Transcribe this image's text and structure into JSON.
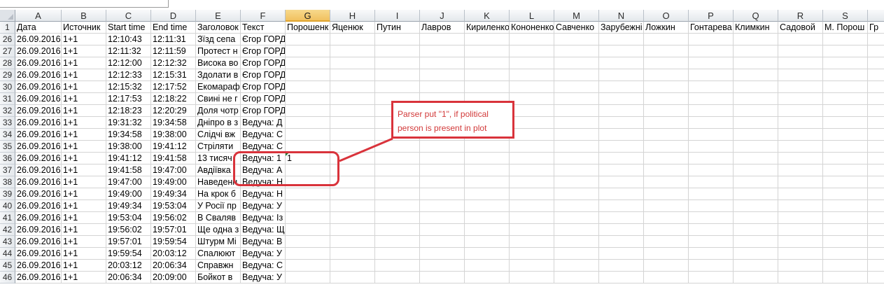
{
  "columns": [
    {
      "letter": "A",
      "width": 66
    },
    {
      "letter": "B",
      "width": 64
    },
    {
      "letter": "C",
      "width": 64
    },
    {
      "letter": "D",
      "width": 64
    },
    {
      "letter": "E",
      "width": 64
    },
    {
      "letter": "F",
      "width": 64
    },
    {
      "letter": "G",
      "width": 64,
      "selected": true
    },
    {
      "letter": "H",
      "width": 64
    },
    {
      "letter": "I",
      "width": 64
    },
    {
      "letter": "J",
      "width": 64
    },
    {
      "letter": "K",
      "width": 64
    },
    {
      "letter": "L",
      "width": 64
    },
    {
      "letter": "M",
      "width": 64
    },
    {
      "letter": "N",
      "width": 64
    },
    {
      "letter": "O",
      "width": 64
    },
    {
      "letter": "P",
      "width": 64
    },
    {
      "letter": "Q",
      "width": 64
    },
    {
      "letter": "R",
      "width": 64
    },
    {
      "letter": "S",
      "width": 64
    },
    {
      "letter": "",
      "width": 24
    }
  ],
  "rows": [
    {
      "num": "1",
      "cells": [
        "Дата",
        "Источник",
        "Start time",
        "End time",
        "Заголовок",
        "Текст",
        "Порошенк",
        "Яценюк",
        "Путин",
        "Лавров",
        "Кириленко",
        "Кононенко",
        "Савченко",
        "Зарубежні",
        "Ложкин",
        "Гонтарева",
        "Климкин",
        "Садовой",
        "М. Порош",
        "Гр"
      ]
    },
    {
      "num": "26",
      "cells": [
        "26.09.2016",
        "1+1",
        "12:10:43",
        "12:11:31",
        "Зїзд сепа",
        "Єгор ГОРД",
        "",
        "",
        "",
        "",
        "",
        "",
        "",
        "",
        "",
        "",
        "",
        "",
        "",
        ""
      ]
    },
    {
      "num": "27",
      "cells": [
        "26.09.2016",
        "1+1",
        "12:11:32",
        "12:11:59",
        "Протест н",
        "Єгор ГОРД",
        "",
        "",
        "",
        "",
        "",
        "",
        "",
        "",
        "",
        "",
        "",
        "",
        "",
        ""
      ]
    },
    {
      "num": "28",
      "cells": [
        "26.09.2016",
        "1+1",
        "12:12:00",
        "12:12:32",
        "Висока во",
        "Єгор ГОРД",
        "",
        "",
        "",
        "",
        "",
        "",
        "",
        "",
        "",
        "",
        "",
        "",
        "",
        ""
      ]
    },
    {
      "num": "29",
      "cells": [
        "26.09.2016",
        "1+1",
        "12:12:33",
        "12:15:31",
        "Здолати в",
        "Єгор ГОРД",
        "",
        "",
        "",
        "",
        "",
        "",
        "",
        "",
        "",
        "",
        "",
        "",
        "",
        ""
      ]
    },
    {
      "num": "30",
      "cells": [
        "26.09.2016",
        "1+1",
        "12:15:32",
        "12:17:52",
        "Екомараф",
        "Єгор ГОРД",
        "",
        "",
        "",
        "",
        "",
        "",
        "",
        "",
        "",
        "",
        "",
        "",
        "",
        ""
      ]
    },
    {
      "num": "31",
      "cells": [
        "26.09.2016",
        "1+1",
        "12:17:53",
        "12:18:22",
        "Свині не г",
        "Єгор ГОРД",
        "",
        "",
        "",
        "",
        "",
        "",
        "",
        "",
        "",
        "",
        "",
        "",
        "",
        ""
      ]
    },
    {
      "num": "32",
      "cells": [
        "26.09.2016",
        "1+1",
        "12:18:23",
        "12:20:29",
        "Доля чотр",
        "Єгор ГОРД",
        "",
        "",
        "",
        "",
        "",
        "",
        "",
        "",
        "",
        "",
        "",
        "",
        "",
        ""
      ]
    },
    {
      "num": "33",
      "cells": [
        "26.09.2016",
        "1+1",
        "19:31:32",
        "19:34:58",
        "Дніпро в з",
        "Ведуча: Д",
        "",
        "",
        "",
        "",
        "",
        "",
        "",
        "",
        "",
        "",
        "",
        "",
        "",
        ""
      ]
    },
    {
      "num": "34",
      "cells": [
        "26.09.2016",
        "1+1",
        "19:34:58",
        "19:38:00",
        "Слідчі вж",
        "Ведуча: С",
        "",
        "",
        "",
        "",
        "",
        "",
        "",
        "",
        "",
        "",
        "",
        "",
        "",
        ""
      ]
    },
    {
      "num": "35",
      "cells": [
        "26.09.2016",
        "1+1",
        "19:38:00",
        "19:41:12",
        "Стріляти",
        "Ведуча: С",
        "",
        "",
        "",
        "",
        "",
        "",
        "",
        "",
        "",
        "",
        "",
        "",
        "",
        ""
      ]
    },
    {
      "num": "36",
      "cells": [
        "26.09.2016",
        "1+1",
        "19:41:12",
        "19:41:58",
        "13 тисяч",
        "Ведуча: 1",
        "1",
        "",
        "",
        "",
        "",
        "",
        "",
        "",
        "",
        "",
        "",
        "",
        "",
        ""
      ]
    },
    {
      "num": "37",
      "cells": [
        "26.09.2016",
        "1+1",
        "19:41:58",
        "19:47:00",
        "Авдіївка",
        "Ведуча: А",
        "",
        "",
        "",
        "",
        "",
        "",
        "",
        "",
        "",
        "",
        "",
        "",
        "",
        ""
      ]
    },
    {
      "num": "38",
      "cells": [
        "26.09.2016",
        "1+1",
        "19:47:00",
        "19:49:00",
        "Наведенн",
        "Ведуча: Н",
        "",
        "",
        "",
        "",
        "",
        "",
        "",
        "",
        "",
        "",
        "",
        "",
        "",
        ""
      ]
    },
    {
      "num": "39",
      "cells": [
        "26.09.2016",
        "1+1",
        "19:49:00",
        "19:49:34",
        "На крок б",
        "Ведуча: Н",
        "",
        "",
        "",
        "",
        "",
        "",
        "",
        "",
        "",
        "",
        "",
        "",
        "",
        ""
      ]
    },
    {
      "num": "40",
      "cells": [
        "26.09.2016",
        "1+1",
        "19:49:34",
        "19:53:04",
        "У Росії пр",
        "Ведуча: У",
        "",
        "",
        "",
        "",
        "",
        "",
        "",
        "",
        "",
        "",
        "",
        "",
        "",
        ""
      ]
    },
    {
      "num": "41",
      "cells": [
        "26.09.2016",
        "1+1",
        "19:53:04",
        "19:56:02",
        "В Сваляв",
        "Ведуча: Із",
        "",
        "",
        "",
        "",
        "",
        "",
        "",
        "",
        "",
        "",
        "",
        "",
        "",
        ""
      ]
    },
    {
      "num": "42",
      "cells": [
        "26.09.2016",
        "1+1",
        "19:56:02",
        "19:57:01",
        "Ще одна з",
        "Ведуча: Щ",
        "",
        "",
        "",
        "",
        "",
        "",
        "",
        "",
        "",
        "",
        "",
        "",
        "",
        ""
      ]
    },
    {
      "num": "43",
      "cells": [
        "26.09.2016",
        "1+1",
        "19:57:01",
        "19:59:54",
        "Штурм Мі",
        "Ведуча: В",
        "",
        "",
        "",
        "",
        "",
        "",
        "",
        "",
        "",
        "",
        "",
        "",
        "",
        ""
      ]
    },
    {
      "num": "44",
      "cells": [
        "26.09.2016",
        "1+1",
        "19:59:54",
        "20:03:12",
        "Спалюют",
        "Ведуча: У",
        "",
        "",
        "",
        "",
        "",
        "",
        "",
        "",
        "",
        "",
        "",
        "",
        "",
        ""
      ]
    },
    {
      "num": "45",
      "cells": [
        "26.09.2016",
        "1+1",
        "20:03:12",
        "20:06:34",
        "Справжн",
        "Ведуча: С",
        "",
        "",
        "",
        "",
        "",
        "",
        "",
        "",
        "",
        "",
        "",
        "",
        "",
        ""
      ]
    },
    {
      "num": "46",
      "cells": [
        "26.09.2016",
        "1+1",
        "20:06:34",
        "20:09:00",
        "Бойкот в",
        "Ведуча: У",
        "",
        "",
        "",
        "",
        "",
        "",
        "",
        "",
        "",
        "",
        "",
        "",
        "",
        ""
      ]
    }
  ],
  "annotation": {
    "text": "Parser put \"1\", if political person is  present in plot",
    "color": "#d9333b"
  }
}
